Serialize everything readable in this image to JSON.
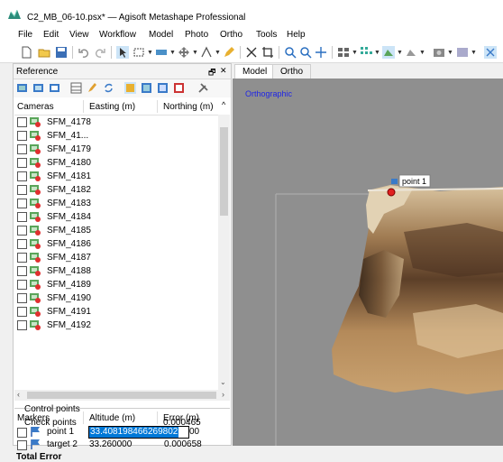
{
  "window": {
    "title": "C2_MB_06-10.psx* — Agisoft Metashape Professional"
  },
  "menu": [
    "File",
    "Edit",
    "View",
    "Workflow",
    "Model",
    "Photo",
    "Ortho",
    "Tools",
    "Help"
  ],
  "reference_panel": {
    "title": "Reference",
    "float_icon": "🗗",
    "close_icon": "✕"
  },
  "cameras_table": {
    "columns": [
      "Cameras",
      "Easting (m)",
      "Northing (m)"
    ],
    "rows": [
      "SFM_4178",
      "SFM_41...",
      "SFM_4179",
      "SFM_4180",
      "SFM_4181",
      "SFM_4182",
      "SFM_4183",
      "SFM_4184",
      "SFM_4185",
      "SFM_4186",
      "SFM_4187",
      "SFM_4188",
      "SFM_4189",
      "SFM_4190",
      "SFM_4191",
      "SFM_4192"
    ]
  },
  "markers_table": {
    "columns": [
      "Markers",
      "Altitude (m)",
      "Error (m)"
    ],
    "rows": [
      {
        "name": "point 1",
        "altitude_editing": "33.408198466269802",
        "error": "00"
      },
      {
        "name": "target 2",
        "altitude": "33.260000",
        "error": "0.000658"
      }
    ],
    "total_error_label": "Total Error",
    "control_points_label": "Control points",
    "check_points_label": "Check points",
    "check_points_error": "0.000465"
  },
  "view": {
    "tabs": [
      "Model",
      "Ortho"
    ],
    "projection_label": "Orthographic",
    "marker_label": "point 1"
  },
  "colors": {
    "accent_blue": "#1e24e6",
    "selection": "#0078d7",
    "marker_red": "#e02020"
  }
}
